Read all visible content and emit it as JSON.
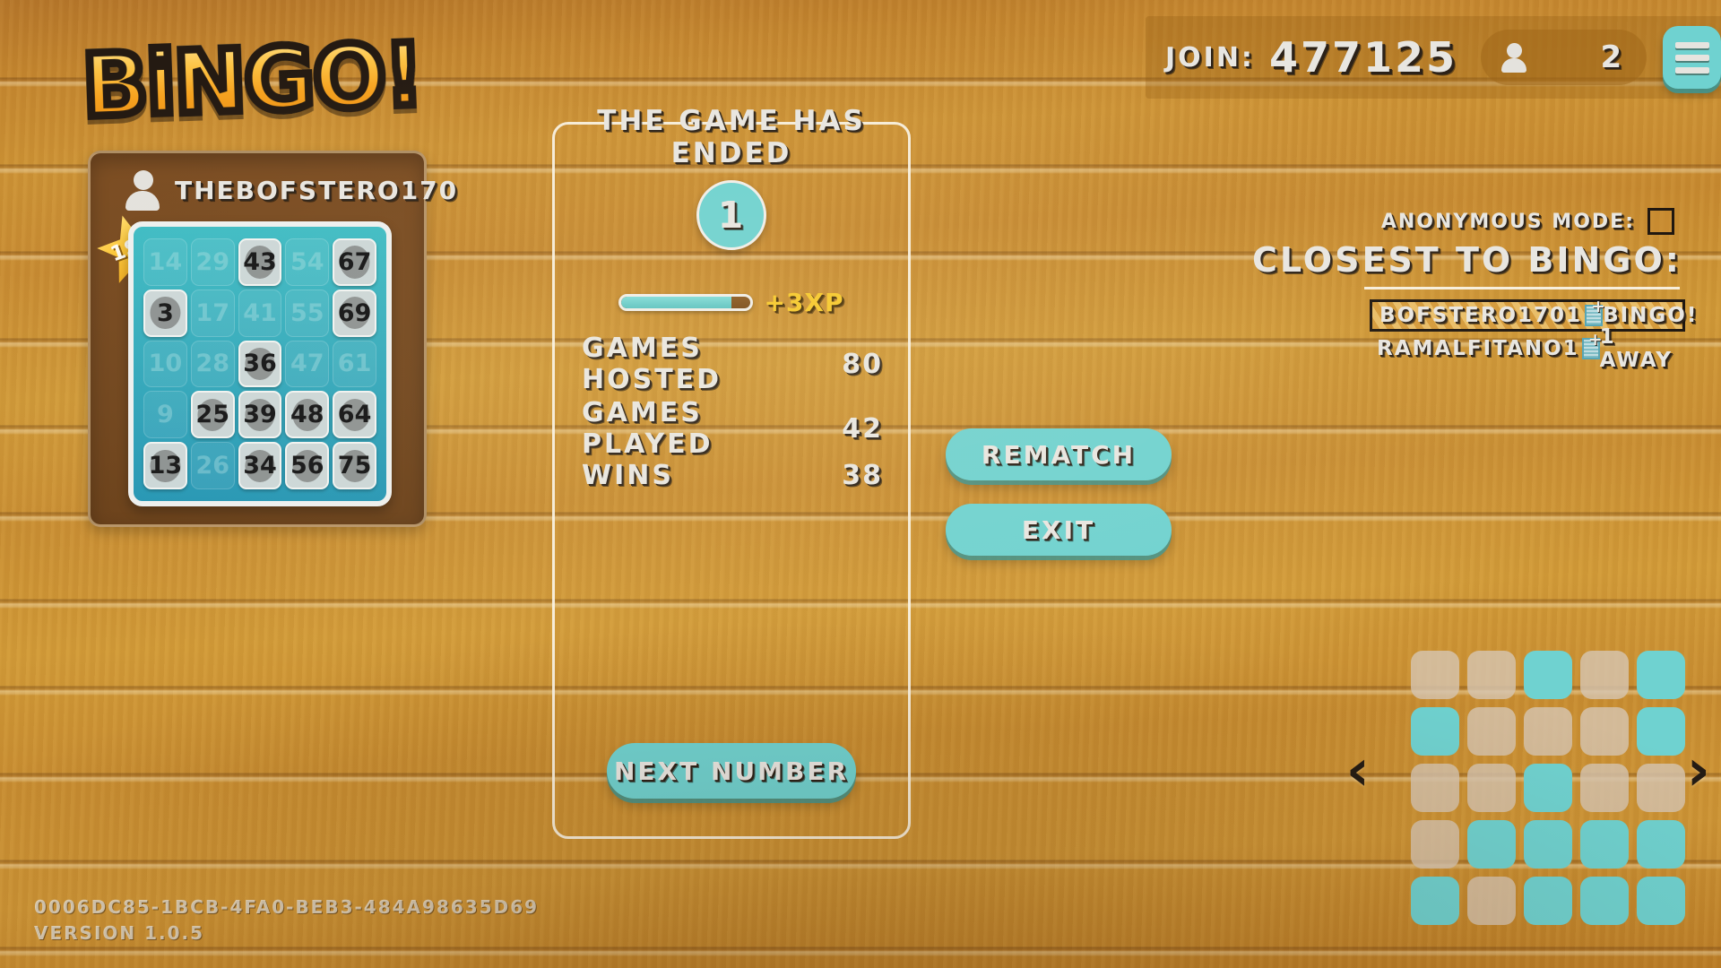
{
  "topbar": {
    "join_label": "JOIN:",
    "join_code": "477125",
    "player_count": "2",
    "person_icon": "person-icon",
    "menu_icon": "hamburger-menu-icon"
  },
  "logo": {
    "text": "BiNGO!"
  },
  "player_card": {
    "username": "THEBOFSTERO170",
    "rank_badge": "1ST",
    "card_numbers": [
      [
        14,
        29,
        43,
        54,
        67
      ],
      [
        3,
        17,
        41,
        55,
        69
      ],
      [
        10,
        28,
        36,
        47,
        61
      ],
      [
        9,
        25,
        39,
        48,
        64
      ],
      [
        13,
        26,
        34,
        56,
        75
      ]
    ],
    "card_marked": [
      [
        false,
        false,
        true,
        false,
        true
      ],
      [
        true,
        false,
        false,
        false,
        true
      ],
      [
        false,
        false,
        true,
        false,
        false
      ],
      [
        false,
        true,
        true,
        true,
        true
      ],
      [
        true,
        false,
        true,
        true,
        true
      ]
    ]
  },
  "center": {
    "title": "THE GAME HAS ENDED",
    "round_number": "1",
    "xp_gain": "+3XP",
    "xp_percent": 85,
    "stats": [
      {
        "label": "GAMES HOSTED",
        "value": "80"
      },
      {
        "label": "GAMES PLAYED",
        "value": "42"
      },
      {
        "label": "WINS",
        "value": "38"
      }
    ],
    "next_number_label": "NEXT NUMBER"
  },
  "actions": {
    "rematch_label": "REMATCH",
    "exit_label": "EXIT"
  },
  "right_panel": {
    "anonymous_label": "ANONYMOUS MODE:",
    "anonymous_checked": false,
    "closest_title": "CLOSEST TO BINGO:",
    "rows": [
      {
        "name": "BOFSTERO170",
        "count": "1",
        "status": "BINGO!",
        "highlight": true
      },
      {
        "name": "RAMALFITANO",
        "count": "1",
        "status": "1 AWAY",
        "highlight": false
      }
    ]
  },
  "minimap": {
    "grid": [
      [
        "off",
        "off",
        "on",
        "off",
        "on"
      ],
      [
        "on",
        "off",
        "off",
        "off",
        "on"
      ],
      [
        "off",
        "off",
        "on",
        "off",
        "off"
      ],
      [
        "off",
        "on",
        "on",
        "on",
        "on"
      ],
      [
        "on",
        "off",
        "on",
        "on",
        "on"
      ]
    ],
    "prev_arrow": "‹",
    "next_arrow": "›"
  },
  "footer": {
    "session_id": "0006DC85-1BCB-4FA0-BEB3-484A98635D69",
    "version": "VERSION 1.0.5"
  },
  "colors": {
    "teal": "#6fd2d0",
    "wood": "#c98e32",
    "gold": "#f6c92c",
    "cream": "#e8e6e1"
  }
}
